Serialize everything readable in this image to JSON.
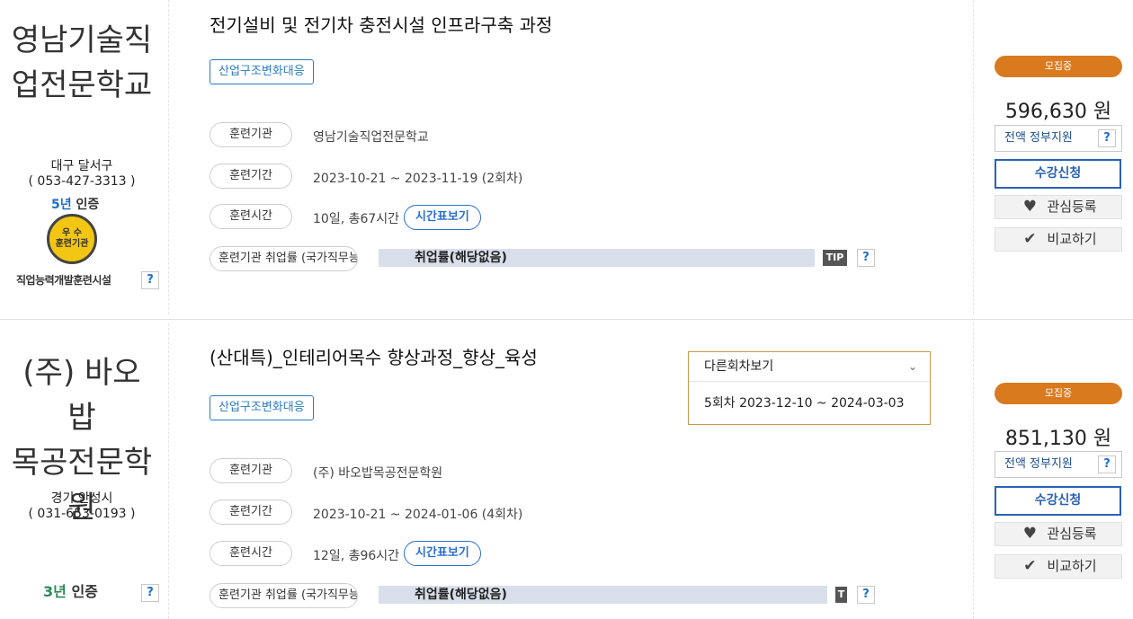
{
  "cards": [
    {
      "org_lines": [
        "영남기술직",
        "업전문학교"
      ],
      "region": "대구 달서구",
      "phone": "( 053-427-3313 )",
      "cert_num": "5년",
      "cert_suffix": "인증",
      "medal_line1": "우 수",
      "medal_line2": "훈련기관",
      "facility": "직업능력개발훈련시설",
      "help": "?",
      "title": "전기설비 및 전기차 충전시설 인프라구축 과정",
      "tag": "산업구조변화대응",
      "rows": {
        "inst_label": "훈련기관",
        "inst_value": "영남기술직업전문학교",
        "period_label": "훈련기간",
        "period_value": "2023-10-21 ~ 2023-11-19 (2회차)",
        "time_label": "훈련시간",
        "time_value": "10일, 총67시간",
        "timetable_btn": "시간표보기",
        "emp_label": "훈련기관 취업률 (국가직무능력표준)",
        "emp_value": "취업률(해당없음)",
        "tip": "TIP"
      },
      "status": "모집중",
      "price": "596,630 원",
      "gov": "전액 정부지원",
      "apply": "수강신청",
      "fav": "관심등록",
      "compare": "비교하기"
    },
    {
      "org_lines": [
        "(주) 바오밥",
        "목공전문학",
        "원"
      ],
      "region": "경기 안성시",
      "phone": "( 031-653-0193 )",
      "cert_num": "3년",
      "cert_suffix": "인증",
      "help": "?",
      "title": "(산대특)_인테리어목수 향상과정_향상_육성",
      "tag": "산업구조변화대응",
      "rows": {
        "inst_label": "훈련기관",
        "inst_value": "(주) 바오밥목공전문학원",
        "period_label": "훈련기간",
        "period_value": "2023-10-21 ~ 2024-01-06 (4회차)",
        "time_label": "훈련시간",
        "time_value": "12일, 총96시간",
        "timetable_btn": "시간표보기",
        "emp_label": "훈련기관 취업률 (국가직무능력표준)",
        "emp_value": "취업률(해당없음)",
        "tip": "T"
      },
      "status": "모집중",
      "price": "851,130 원",
      "gov": "전액 정부지원",
      "apply": "수강신청",
      "fav": "관심등록",
      "compare": "비교하기",
      "dropdown": {
        "head": "다른회차보기",
        "item": "5회차 2023-12-10 ~ 2024-03-03"
      }
    }
  ],
  "icons": {
    "heart": "heart-icon",
    "check": "check-icon",
    "chevron": "chevron-down-icon"
  },
  "colors": {
    "accent_blue": "#2a62b5",
    "status_orange": "#d97a1f",
    "tag_blue": "#2b7bbd"
  }
}
